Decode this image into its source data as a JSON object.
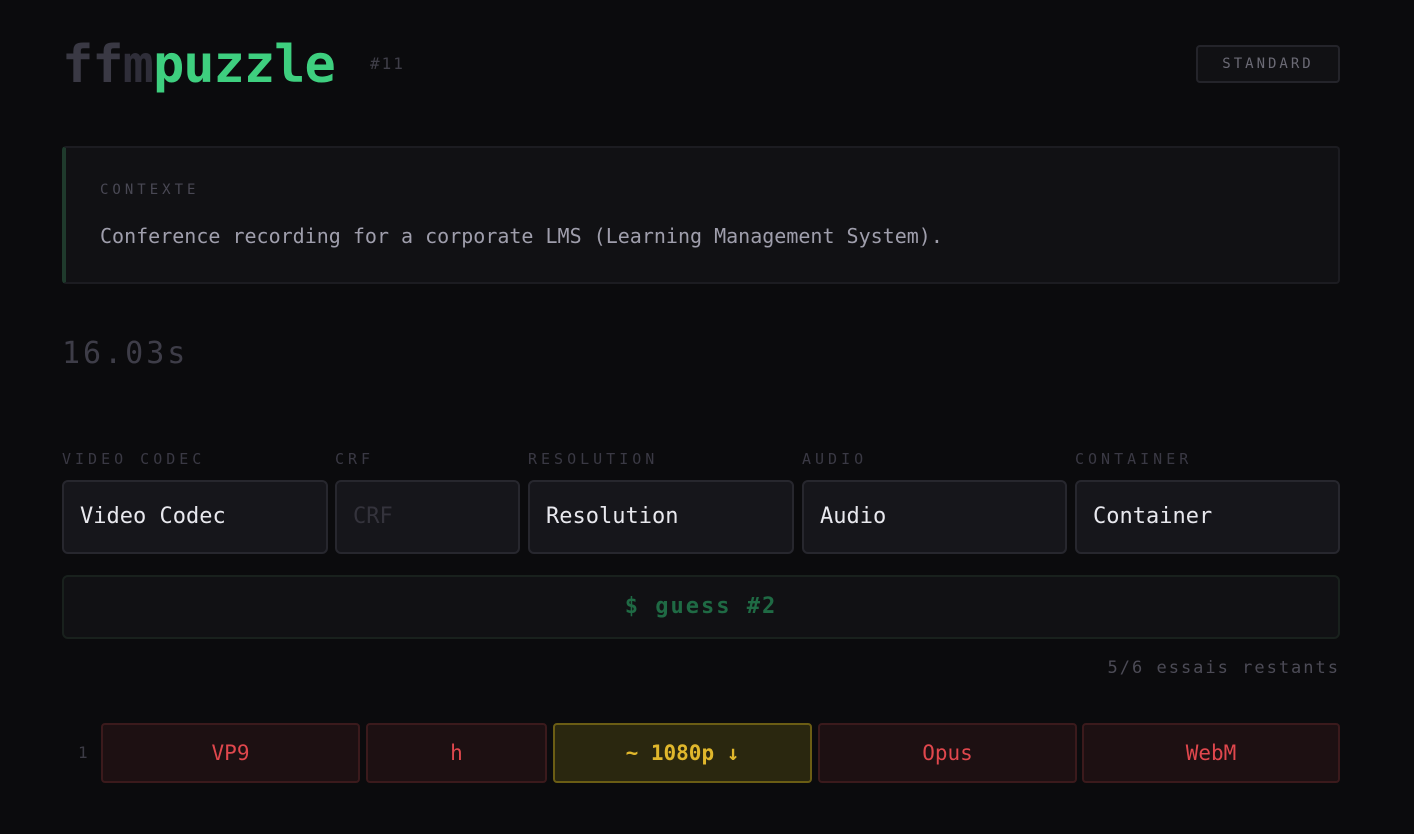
{
  "header": {
    "logo_ff": "ff",
    "logo_m": "m",
    "logo_puzzle": "puzzle",
    "puzzle_number": "#11",
    "mode": "STANDARD"
  },
  "context": {
    "label": "CONTEXTE",
    "text": "Conference recording for a corporate LMS (Learning Management System)."
  },
  "timer": "16.03s",
  "fields": [
    {
      "label": "VIDEO CODEC",
      "value": "Video Codec",
      "placeholder": ""
    },
    {
      "label": "CRF",
      "value": "",
      "placeholder": "CRF"
    },
    {
      "label": "RESOLUTION",
      "value": "Resolution",
      "placeholder": ""
    },
    {
      "label": "AUDIO",
      "value": "Audio",
      "placeholder": ""
    },
    {
      "label": "CONTAINER",
      "value": "Container",
      "placeholder": ""
    }
  ],
  "guess_button": "$ guess #2",
  "remaining": "5/6 essais restants",
  "history": [
    {
      "index": "1",
      "cells": [
        {
          "text": "VP9",
          "status": "wrong"
        },
        {
          "text": "h",
          "status": "wrong"
        },
        {
          "text": "~ 1080p ↓",
          "status": "partial"
        },
        {
          "text": "Opus",
          "status": "wrong"
        },
        {
          "text": "WebM",
          "status": "wrong"
        }
      ]
    }
  ],
  "colors": {
    "accent": "#3ecf7f",
    "wrong": "#e0474d",
    "partial": "#e0b72c",
    "background": "#0b0b0d"
  }
}
